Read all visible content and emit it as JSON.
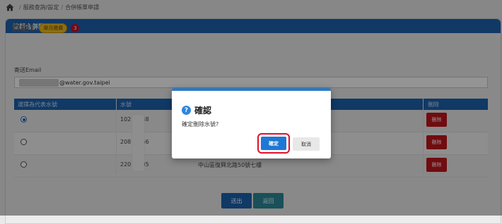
{
  "breadcrumb": {
    "items": [
      "服務查詢/設定",
      "合併帳單申請"
    ],
    "separator": "/"
  },
  "panel": {
    "title": "編輯合併群組"
  },
  "group": {
    "name": "群組1",
    "type_badge": "單月繳費",
    "count": "3"
  },
  "email": {
    "label": "寄送Email",
    "domain": "@water.gov.taipei"
  },
  "table": {
    "headers": [
      "選擇為代表水號",
      "水號",
      "刪除"
    ],
    "rows": [
      {
        "selected": true,
        "water_prefix": "102",
        "water_suffix": "748",
        "delete_label": "刪除"
      },
      {
        "selected": false,
        "water_prefix": "208",
        "water_suffix": "056",
        "delete_label": "刪除"
      },
      {
        "selected": false,
        "water_prefix": "220",
        "water_suffix": "905",
        "address": "中山區復興北路50號七樓",
        "delete_label": "刪除"
      }
    ]
  },
  "buttons": {
    "submit": "送出",
    "back": "返回"
  },
  "dialog": {
    "title": "確認",
    "message": "確定刪除水號?",
    "confirm": "確定",
    "cancel": "取消"
  },
  "colors": {
    "primary": "#1d62b0",
    "danger": "#c3161c",
    "highlight": "#e0102a"
  }
}
